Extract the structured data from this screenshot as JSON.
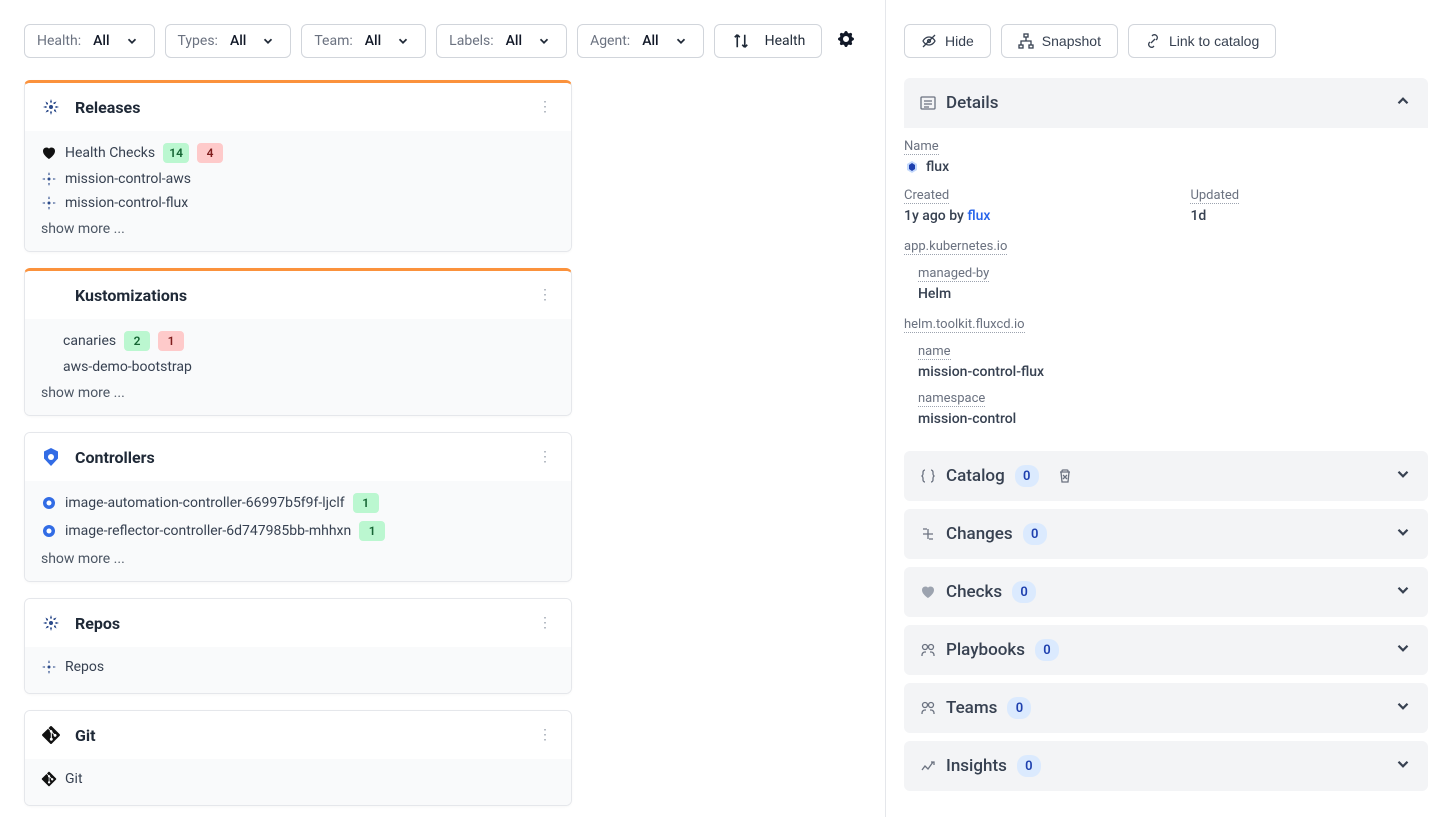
{
  "filters": {
    "health": {
      "label": "Health:",
      "value": "All"
    },
    "types": {
      "label": "Types:",
      "value": "All"
    },
    "team": {
      "label": "Team:",
      "value": "All"
    },
    "labels": {
      "label": "Labels:",
      "value": "All"
    },
    "agent": {
      "label": "Agent:",
      "value": "All"
    },
    "sort": "Health"
  },
  "cards": {
    "releases": {
      "title": "Releases",
      "health_checks": {
        "label": "Health Checks",
        "green": "14",
        "red": "4"
      },
      "items": [
        "mission-control-aws",
        "mission-control-flux"
      ],
      "show_more": "show more ..."
    },
    "kustomizations": {
      "title": "Kustomizations",
      "canaries": {
        "label": "canaries",
        "green": "2",
        "red": "1"
      },
      "items": [
        "aws-demo-bootstrap"
      ],
      "show_more": "show more ..."
    },
    "controllers": {
      "title": "Controllers",
      "items": [
        {
          "name": "image-automation-controller-66997b5f9f-ljclf",
          "count": "1"
        },
        {
          "name": "image-reflector-controller-6d747985bb-mhhxn",
          "count": "1"
        }
      ],
      "show_more": "show more ..."
    },
    "repos": {
      "title": "Repos",
      "item": "Repos"
    },
    "git": {
      "title": "Git",
      "item": "Git"
    }
  },
  "side": {
    "actions": {
      "hide": "Hide",
      "snapshot": "Snapshot",
      "link": "Link to catalog"
    },
    "details": {
      "title": "Details",
      "name": {
        "label": "Name",
        "value": "flux"
      },
      "created": {
        "label": "Created",
        "value": "1y ago by ",
        "link": "flux"
      },
      "updated": {
        "label": "Updated",
        "value": "1d"
      },
      "k8s": {
        "heading": "app.kubernetes.io",
        "managed_label": "managed-by",
        "managed_value": "Helm"
      },
      "helm": {
        "heading": "helm.toolkit.fluxcd.io",
        "name_label": "name",
        "name_value": "mission-control-flux",
        "ns_label": "namespace",
        "ns_value": "mission-control"
      }
    },
    "sections": {
      "catalog": {
        "title": "Catalog",
        "count": "0"
      },
      "changes": {
        "title": "Changes",
        "count": "0"
      },
      "checks": {
        "title": "Checks",
        "count": "0"
      },
      "playbooks": {
        "title": "Playbooks",
        "count": "0"
      },
      "teams": {
        "title": "Teams",
        "count": "0"
      },
      "insights": {
        "title": "Insights",
        "count": "0"
      }
    }
  }
}
